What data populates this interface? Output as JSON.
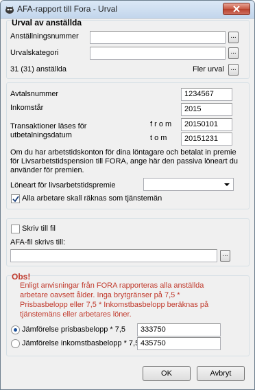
{
  "window": {
    "title": "AFA-rapport till Fora - Urval"
  },
  "urval": {
    "heading": "Urval av anställda",
    "anstallningsnummer_label": "Anställningsnummer",
    "anstallningsnummer_value": "",
    "urvalskategori_label": "Urvalskategori",
    "urvalskategori_value": "",
    "count_text": "31 (31) anställda",
    "fler_urval_label": "Fler urval",
    "dots": "..."
  },
  "avtal": {
    "avtalsnummer_label": "Avtalsnummer",
    "avtalsnummer_value": "1234567",
    "inkomstar_label": "Inkomstår",
    "inkomstar_value": "2015",
    "transaktioner_label_line1": "Transaktioner läses för",
    "transaktioner_label_line2": "utbetalningsdatum",
    "from_label": "f r o m",
    "from_value": "20150101",
    "tom_label": "t o m",
    "tom_value": "20151231",
    "info_text": "Om du har arbetstidskonton för dina löntagare och betalat in premie för Livsarbetstidspension till FORA, ange här den passiva löneart du använder för premien.",
    "loneart_label": "Löneart för livsarbetstidspremie",
    "loneart_value": "",
    "tjanstemann_label": "Alla arbetare skall räknas som tjänstemän",
    "tjanstemann_checked": true
  },
  "fil": {
    "skriv_label": "Skriv till fil",
    "skriv_checked": false,
    "path_label": "AFA-fil skrivs till:",
    "path_value": ""
  },
  "obs": {
    "heading": "Obs!",
    "text": "Enligt anvisningar från FORA rapporteras alla anställda arbetare oavsett ålder. Inga brytgränser på 7,5 * Prisbasbelopp eller 7,5 * Inkomstbasbelopp beräknas på tjänstemäns eller arbetares löner.",
    "pris_label": "Jämförelse prisbasbelopp * 7,5",
    "pris_value": "333750",
    "inkomst_label": "Jämförelse inkomstbasbelopp * 7,5",
    "inkomst_value": "435750",
    "selected": "pris"
  },
  "buttons": {
    "ok": "OK",
    "cancel": "Avbryt"
  },
  "colors": {
    "obs_red": "#c0392b",
    "accent": "#1a4f9a"
  }
}
